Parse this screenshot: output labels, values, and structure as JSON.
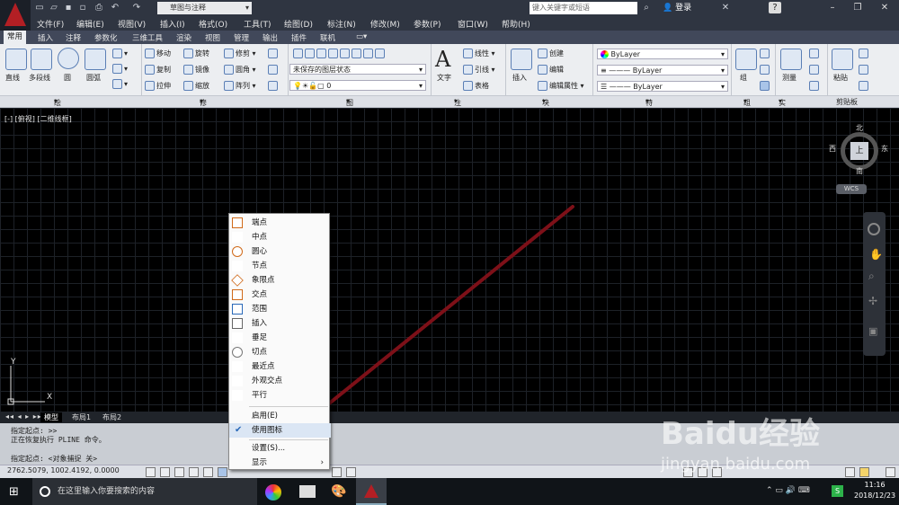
{
  "title_bar": {
    "workspace": "草图与注释",
    "search_placeholder": "键入关键字或短语",
    "login": "登录"
  },
  "menu": [
    "文件(F)",
    "编辑(E)",
    "视图(V)",
    "插入(I)",
    "格式(O)",
    "工具(T)",
    "绘图(D)",
    "标注(N)",
    "修改(M)",
    "参数(P)",
    "窗口(W)",
    "帮助(H)"
  ],
  "tabs": [
    "常用",
    "插入",
    "注释",
    "参数化",
    "三维工具",
    "渲染",
    "视图",
    "管理",
    "输出",
    "插件",
    "联机"
  ],
  "ribbon": {
    "draw": {
      "line": "直线",
      "pline": "多段线",
      "circle": "圆",
      "arc": "圆弧"
    },
    "modify": {
      "move": "移动",
      "rotate": "旋转",
      "trim": "修剪",
      "copy": "复制",
      "mirror": "镜像",
      "fillet": "圆角",
      "stretch": "拉伸",
      "scale": "缩放",
      "array": "阵列"
    },
    "layer": {
      "state": "未保存的图层状态",
      "current": "0"
    },
    "annotation": {
      "text": "文字",
      "linear": "线性",
      "leader": "引线",
      "table": "表格"
    },
    "block": {
      "insert": "插入",
      "create": "创建",
      "edit": "编辑",
      "attr": "编辑属性"
    },
    "properties": {
      "color": "ByLayer",
      "linetype": "ByLayer",
      "lineweight": "ByLayer"
    },
    "groups": {
      "group": "组"
    },
    "utilities": {
      "measure": "测量"
    },
    "clipboard": {
      "paste": "粘贴"
    },
    "panels": [
      "绘图",
      "修改",
      "图层",
      "注释",
      "块",
      "特性",
      "组",
      "实用工具",
      "剪贴板"
    ]
  },
  "viewport": {
    "label": "[-] [俯视] [二维线框]",
    "compass": {
      "n": "北",
      "s": "南",
      "e": "东",
      "w": "西",
      "top": "上",
      "wcs": "WCS"
    },
    "axis_y": "Y",
    "axis_x": "X"
  },
  "layout_tabs": [
    "模型",
    "布局1",
    "布局2"
  ],
  "command_lines": [
    "指定起点:  >>",
    "正在恢复执行 PLINE 命令。",
    "指定起点: <对象捕捉 关>"
  ],
  "status": {
    "coords": "2762.5079, 1002.4192, 0.0000"
  },
  "context_menu": {
    "items": [
      {
        "label": "端点",
        "icon": "endpoint-icon"
      },
      {
        "label": "中点",
        "icon": "midpoint-icon"
      },
      {
        "label": "圆心",
        "icon": "center-icon"
      },
      {
        "label": "节点",
        "icon": "node-icon"
      },
      {
        "label": "象限点",
        "icon": "quadrant-icon"
      },
      {
        "label": "交点",
        "icon": "intersection-icon"
      },
      {
        "label": "范围",
        "icon": "extension-icon"
      },
      {
        "label": "插入",
        "icon": "insertion-icon"
      },
      {
        "label": "垂足",
        "icon": "perpendicular-icon"
      },
      {
        "label": "切点",
        "icon": "tangent-icon"
      },
      {
        "label": "最近点",
        "icon": "nearest-icon"
      },
      {
        "label": "外观交点",
        "icon": "apparent-intersection-icon"
      },
      {
        "label": "平行",
        "icon": "parallel-icon"
      }
    ],
    "enable": "启用(E)",
    "use_icons": "使用图标",
    "settings": "设置(S)...",
    "display": "显示"
  },
  "taskbar": {
    "search": "在这里输入你要搜索的内容",
    "time": "11:16",
    "date": "2018/12/23"
  },
  "watermark": {
    "text": "Baidu经验",
    "url": "jingyan.baidu.com"
  },
  "colors": {
    "arrow": "#7d1018",
    "accent": "#2a69b8"
  }
}
